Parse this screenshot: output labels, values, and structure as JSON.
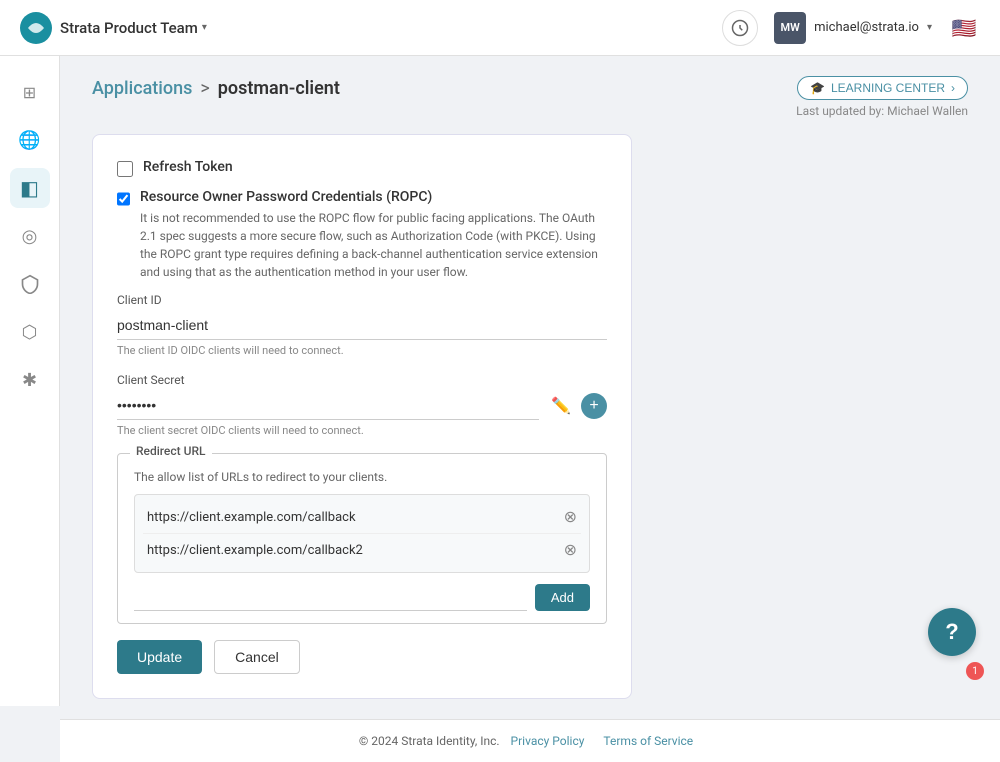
{
  "app": {
    "logo_label": "Strata",
    "org_name": "Strata Product Team",
    "user_initials": "MW",
    "user_email": "michael@strata.io",
    "flag_emoji": "🇺🇸"
  },
  "nav": {
    "learning_center_label": "LEARNING CENTER",
    "last_updated": "Last updated by: Michael Wallen"
  },
  "breadcrumb": {
    "parent": "Applications",
    "separator": ">",
    "current": "postman-client"
  },
  "sidebar": {
    "items": [
      {
        "id": "home",
        "icon": "⊞",
        "active": false
      },
      {
        "id": "globe",
        "icon": "🌐",
        "active": false
      },
      {
        "id": "layers",
        "icon": "◧",
        "active": true
      },
      {
        "id": "users",
        "icon": "◎",
        "active": false
      },
      {
        "id": "shield",
        "icon": "⛉",
        "active": false
      },
      {
        "id": "gem",
        "icon": "⬡",
        "active": false
      },
      {
        "id": "settings",
        "icon": "✱",
        "active": false
      }
    ]
  },
  "form": {
    "refresh_token_label": "Refresh Token",
    "refresh_token_checked": false,
    "ropc_label": "Resource Owner Password Credentials (ROPC)",
    "ropc_checked": true,
    "ropc_description": "It is not recommended to use the ROPC flow for public facing applications. The OAuth 2.1 spec suggests a more secure flow, such as Authorization Code (with PKCE). Using the ROPC grant type requires defining a back-channel authentication service extension and using that as the authentication method in your user flow.",
    "client_id_label": "Client ID",
    "client_id_value": "postman-client",
    "client_id_hint": "The client ID OIDC clients will need to connect.",
    "client_secret_label": "Client Secret",
    "client_secret_value": "••••••••",
    "client_secret_hint": "The client secret OIDC clients will need to connect.",
    "redirect_url_legend": "Redirect URL",
    "redirect_url_desc": "The allow list of URLs to redirect to your clients.",
    "redirect_urls": [
      {
        "url": "https://client.example.com/callback"
      },
      {
        "url": "https://client.example.com/callback2"
      }
    ],
    "add_url_placeholder": "",
    "add_btn_label": "Add",
    "update_btn_label": "Update",
    "cancel_btn_label": "Cancel"
  },
  "footer": {
    "copyright": "© 2024 Strata Identity, Inc.",
    "privacy_label": "Privacy Policy",
    "terms_label": "Terms of Service"
  },
  "help": {
    "badge_count": "1",
    "icon": "?"
  }
}
